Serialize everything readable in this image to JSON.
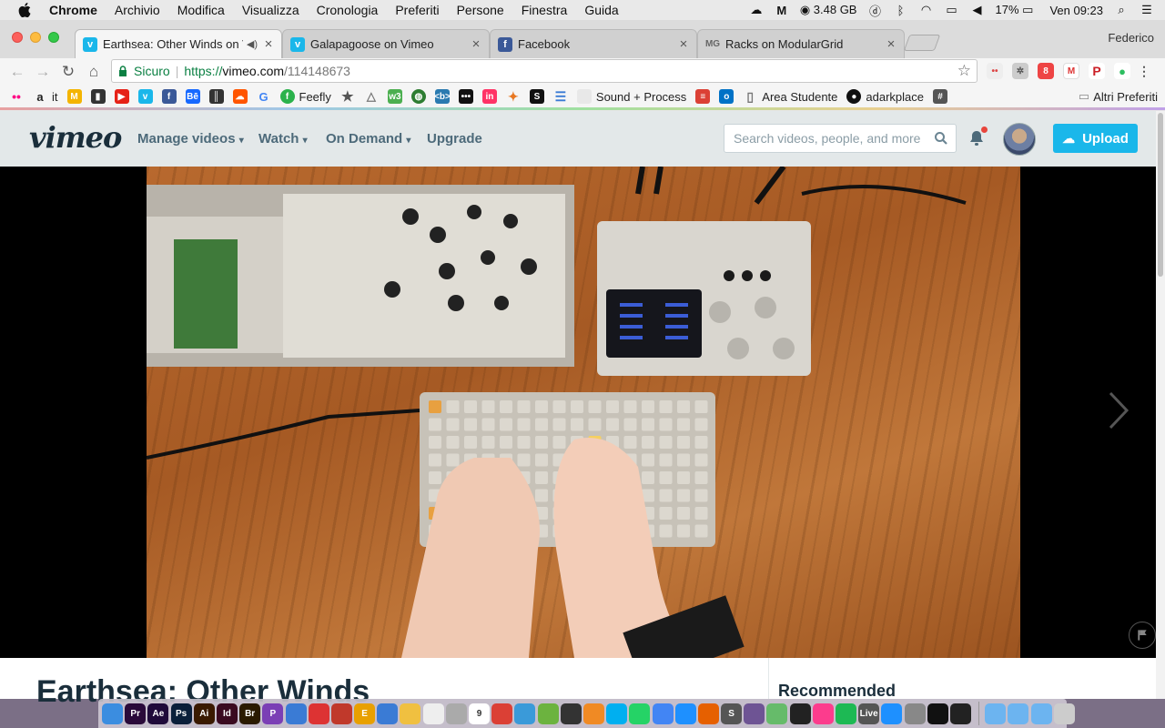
{
  "menubar": {
    "app": "Chrome",
    "items": [
      "Archivio",
      "Modifica",
      "Visualizza",
      "Cronologia",
      "Preferiti",
      "Persone",
      "Finestra",
      "Guida"
    ],
    "memory": "3.48 GB",
    "battery": "17%",
    "clock": "Ven 09:23"
  },
  "browser": {
    "profile": "Federico",
    "tabs": [
      {
        "title": "Earthsea: Other Winds on V",
        "favicon": "vimeo-icon",
        "color": "#1ab7ea",
        "active": true
      },
      {
        "title": "Galapagoose on Vimeo",
        "favicon": "vimeo-icon",
        "color": "#1ab7ea",
        "active": false
      },
      {
        "title": "Facebook",
        "favicon": "facebook-icon",
        "color": "#3b5998",
        "active": false
      },
      {
        "title": "Racks on ModularGrid",
        "favicon": "modulargrid-icon",
        "color": "#888888",
        "active": false
      }
    ],
    "address": {
      "secure_label": "Sicuro",
      "scheme": "https://",
      "host": "vimeo.com",
      "path": "/114148673"
    },
    "bookmarks": [
      {
        "label": "",
        "icon": "flickr-icon",
        "color": "#ff0084"
      },
      {
        "label": "it",
        "icon": "amazon-icon",
        "color": "#222222"
      },
      {
        "label": "",
        "icon": "m-icon",
        "color": "#e8a000"
      },
      {
        "label": "",
        "icon": "piano-icon",
        "color": "#444444"
      },
      {
        "label": "",
        "icon": "youtube-icon",
        "color": "#e62117"
      },
      {
        "label": "",
        "icon": "vimeo-icon",
        "color": "#1ab7ea"
      },
      {
        "label": "",
        "icon": "facebook-icon",
        "color": "#3b5998"
      },
      {
        "label": "",
        "icon": "behance-icon",
        "color": "#1769ff"
      },
      {
        "label": "",
        "icon": "bars-icon",
        "color": "#333333"
      },
      {
        "label": "",
        "icon": "soundcloud-icon",
        "color": "#ff5500"
      },
      {
        "label": "",
        "icon": "google-icon",
        "color": "#4285f4"
      },
      {
        "label": "Feefly",
        "icon": "feedly-icon",
        "color": "#2bb24c"
      },
      {
        "label": "",
        "icon": "star-icon",
        "color": "#555555"
      },
      {
        "label": "",
        "icon": "triangle-icon",
        "color": "#777777"
      },
      {
        "label": "",
        "icon": "w3-icon",
        "color": "#4caf50"
      },
      {
        "label": "",
        "icon": "globe-icon",
        "color": "#2e7d32"
      },
      {
        "label": "",
        "icon": "code-icon",
        "color": "#2a7ab0"
      },
      {
        "label": "",
        "icon": "dots-icon",
        "color": "#111111"
      },
      {
        "label": "",
        "icon": "invision-icon",
        "color": "#ff3366"
      },
      {
        "label": "",
        "icon": "fox-icon",
        "color": "#e87722"
      },
      {
        "label": "",
        "icon": "s-icon",
        "color": "#111111"
      },
      {
        "label": "",
        "icon": "filter-icon",
        "color": "#3a7bd5"
      },
      {
        "label": "Sound + Process",
        "icon": "blank-page-icon",
        "color": "#dddddd"
      },
      {
        "label": "",
        "icon": "todoist-icon",
        "color": "#db4035"
      },
      {
        "label": "",
        "icon": "outlook-icon",
        "color": "#0072c6"
      },
      {
        "label": "Area Studente",
        "icon": "page-icon",
        "color": "#999999"
      },
      {
        "label": "adarkplace",
        "icon": "github-icon",
        "color": "#111111"
      },
      {
        "label": "",
        "icon": "hash-icon",
        "color": "#555555"
      }
    ],
    "other_bookmarks": "Altri Preferiti"
  },
  "vimeo": {
    "nav": [
      "Manage videos",
      "Watch",
      "On Demand",
      "Upgrade"
    ],
    "search_placeholder": "Search videos, people, and more",
    "upload_label": "Upload",
    "video_title": "Earthsea: Other Winds",
    "recommended_label": "Recommended"
  },
  "dock": [
    {
      "icon": "finder-icon",
      "color": "#3b8de0",
      "text": ""
    },
    {
      "icon": "premiere-icon",
      "color": "#2a0a3a",
      "text": "Pr"
    },
    {
      "icon": "after-effects-icon",
      "color": "#1f0a3a",
      "text": "Ae"
    },
    {
      "icon": "photoshop-icon",
      "color": "#0a1f3a",
      "text": "Ps"
    },
    {
      "icon": "illustrator-icon",
      "color": "#3a1a00",
      "text": "Ai"
    },
    {
      "icon": "indesign-icon",
      "color": "#3a0a20",
      "text": "Id"
    },
    {
      "icon": "bridge-icon",
      "color": "#2a1a00",
      "text": "Br"
    },
    {
      "icon": "p-icon",
      "color": "#7b3fb5",
      "text": "P"
    },
    {
      "icon": "network-icon",
      "color": "#3a7bd5",
      "text": ""
    },
    {
      "icon": "sketchup-icon",
      "color": "#d33",
      "text": ""
    },
    {
      "icon": "autocad-icon",
      "color": "#c0392b",
      "text": ""
    },
    {
      "icon": "e-icon",
      "color": "#e8a000",
      "text": "E"
    },
    {
      "icon": "bird-icon",
      "color": "#3a7bd5",
      "text": ""
    },
    {
      "icon": "photos-icon",
      "color": "#f0c040",
      "text": ""
    },
    {
      "icon": "notes-icon",
      "color": "#eeeeee",
      "text": ""
    },
    {
      "icon": "book-icon",
      "color": "#aaaaaa",
      "text": ""
    },
    {
      "icon": "calendar-icon",
      "color": "#ffffff",
      "text": "9"
    },
    {
      "icon": "todoist-icon",
      "color": "#db4035",
      "text": ""
    },
    {
      "icon": "cloud-icon",
      "color": "#3a9ad9",
      "text": ""
    },
    {
      "icon": "utorrent-icon",
      "color": "#6cb33f",
      "text": ""
    },
    {
      "icon": "cursor-icon",
      "color": "#333333",
      "text": ""
    },
    {
      "icon": "vlc-icon",
      "color": "#f08a24",
      "text": ""
    },
    {
      "icon": "skype-icon",
      "color": "#00aff0",
      "text": ""
    },
    {
      "icon": "whatsapp-icon",
      "color": "#25d366",
      "text": ""
    },
    {
      "icon": "chrome-icon",
      "color": "#4285f4",
      "text": ""
    },
    {
      "icon": "safari-icon",
      "color": "#1e90ff",
      "text": ""
    },
    {
      "icon": "firefox-icon",
      "color": "#e66000",
      "text": ""
    },
    {
      "icon": "s-note-icon",
      "color": "#555555",
      "text": "S"
    },
    {
      "icon": "github-desktop-icon",
      "color": "#6e5494",
      "text": ""
    },
    {
      "icon": "atom-icon",
      "color": "#66bb6a",
      "text": ""
    },
    {
      "icon": "beats-icon",
      "color": "#222222",
      "text": ""
    },
    {
      "icon": "itunes-icon",
      "color": "#fc3c8d",
      "text": ""
    },
    {
      "icon": "spotify-icon",
      "color": "#1db954",
      "text": ""
    },
    {
      "icon": "live-icon",
      "color": "#555555",
      "text": "Live"
    },
    {
      "icon": "app-store-icon",
      "color": "#1e90ff",
      "text": ""
    },
    {
      "icon": "system-preferences-icon",
      "color": "#888888",
      "text": ""
    },
    {
      "icon": "terminal-icon",
      "color": "#111111",
      "text": ""
    },
    {
      "icon": "activity-monitor-icon",
      "color": "#222222",
      "text": ""
    },
    {
      "icon": "folder-icon",
      "color": "#6cb4f0",
      "text": ""
    },
    {
      "icon": "folder-icon",
      "color": "#6cb4f0",
      "text": ""
    },
    {
      "icon": "folder-icon",
      "color": "#6cb4f0",
      "text": ""
    },
    {
      "icon": "trash-icon",
      "color": "#cccccc",
      "text": ""
    }
  ]
}
